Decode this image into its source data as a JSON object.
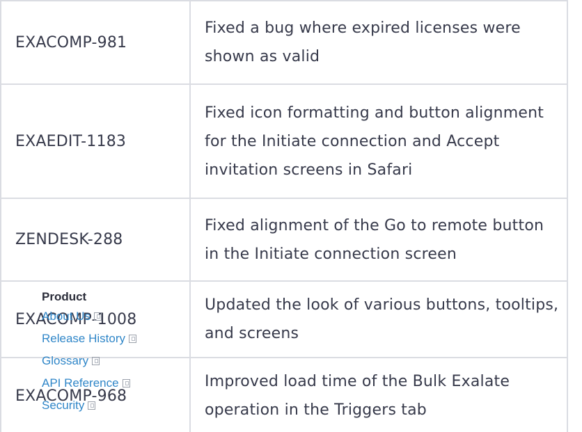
{
  "changelog": {
    "rows": [
      {
        "key": "EXACOMP-981",
        "description": "Fixed a bug where expired licenses were shown as valid"
      },
      {
        "key": "EXAEDIT-1183",
        "description": "Fixed icon formatting and button alignment for the Initiate connection and Accept invitation screens in Safari"
      },
      {
        "key": "ZENDESK-288",
        "description": "Fixed alignment of the Go to remote button in the Initiate connection screen"
      },
      {
        "key": "EXACOMP-1008",
        "description": "Updated the look of various buttons, tooltips, and screens"
      },
      {
        "key": "EXACOMP-968",
        "description": "Improved load time of the Bulk Exalate operation in the Triggers tab"
      }
    ]
  },
  "footer": {
    "heading": "Product",
    "links": [
      {
        "label": "About Us",
        "icon": "external-link-icon"
      },
      {
        "label": "Release History",
        "icon": "external-link-icon"
      },
      {
        "label": "Glossary",
        "icon": "external-link-icon"
      },
      {
        "label": "API Reference",
        "icon": "external-link-icon"
      },
      {
        "label": "Security",
        "icon": "external-link-icon"
      }
    ]
  },
  "colors": {
    "text": "#36394a",
    "border": "#dadce2",
    "link": "#2f86c8",
    "heading": "#2b2d3a"
  }
}
